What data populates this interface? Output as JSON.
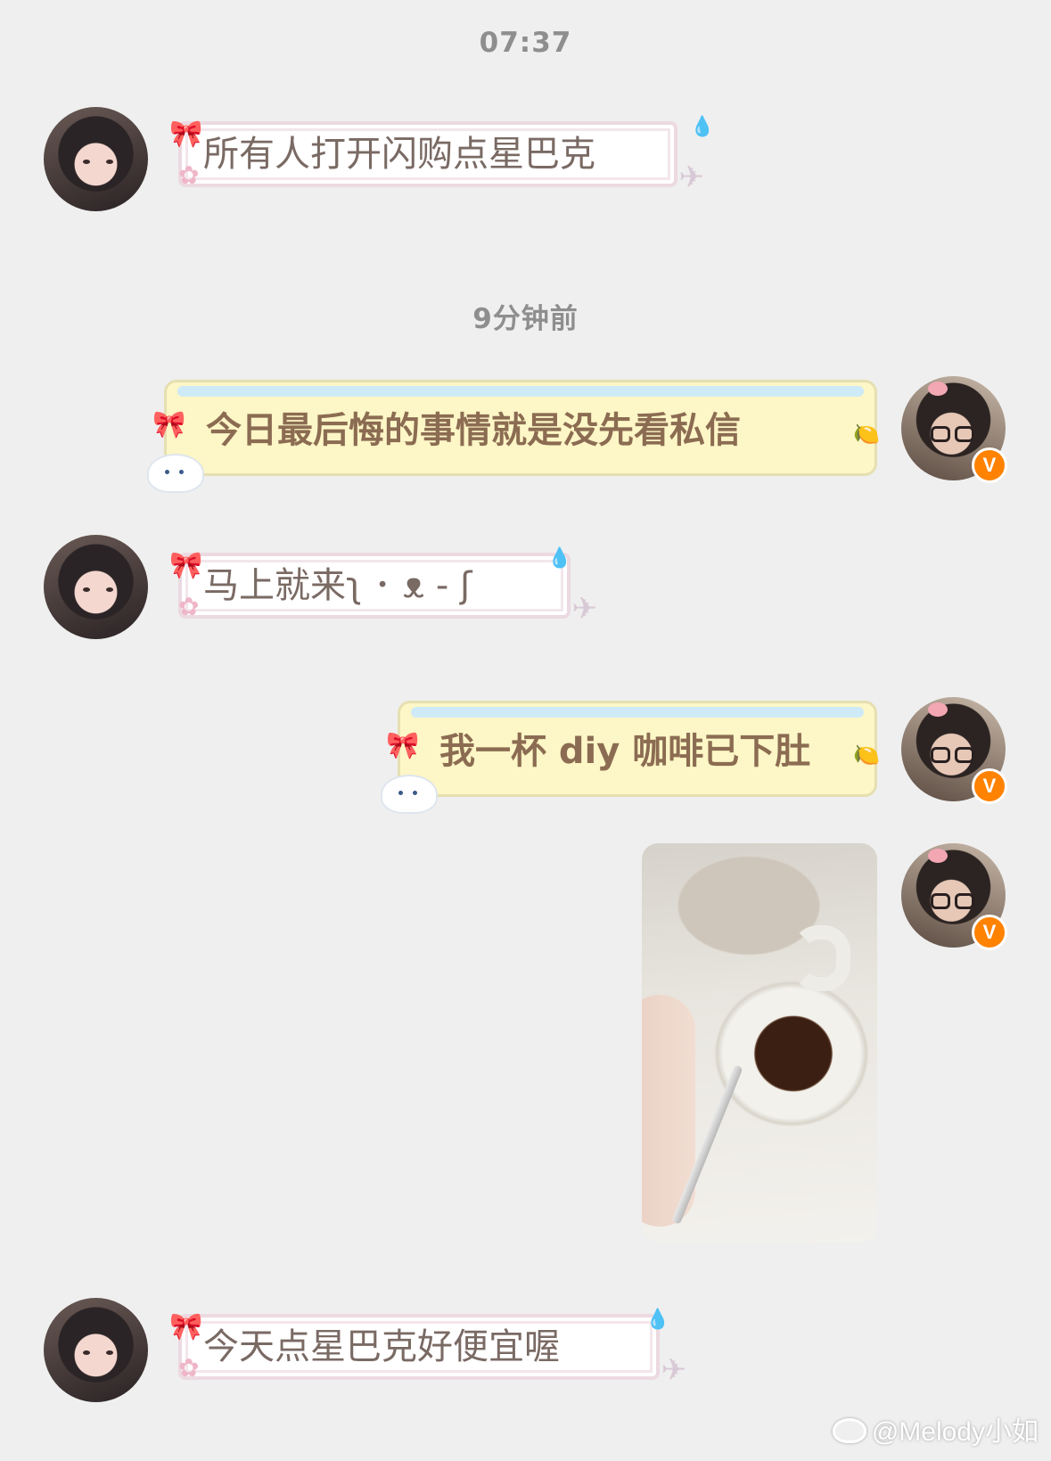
{
  "timestamps": [
    "07:37",
    "9分钟前"
  ],
  "messages": [
    {
      "side": "left",
      "text": "所有人打开闪购点星巴克"
    },
    {
      "side": "right",
      "text": "今日最后悔的事情就是没先看私信"
    },
    {
      "side": "left",
      "text": "马上就来ʅ ･ ᴥ - ʃ"
    },
    {
      "side": "right",
      "text": "我一杯 diy 咖啡已下肚"
    },
    {
      "side": "right",
      "type": "image"
    },
    {
      "side": "left",
      "text": "今天点星巴克好便宜喔"
    }
  ],
  "badge": {
    "verified_label": "V",
    "color": "#ff8200"
  },
  "watermark": {
    "text": "@Melody小如",
    "icon": "weibo-logo-icon"
  },
  "colors": {
    "background": "#efefef",
    "sent_bubble": "#fdf6c6",
    "received_bubble": "#ffffff"
  }
}
